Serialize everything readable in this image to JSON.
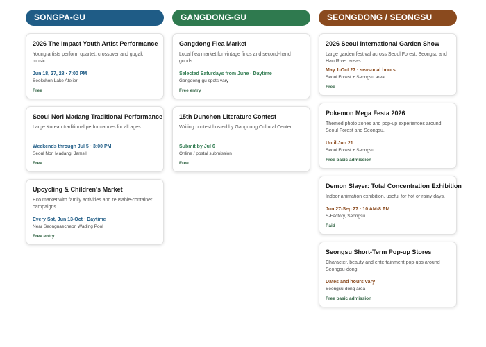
{
  "colors": {
    "songpa": "#1f5c86",
    "gangdong": "#2f7a4f",
    "seongdong": "#8a4a1e"
  },
  "columns": [
    {
      "header": "SONGPA-GU",
      "cards": [
        {
          "title": "2026 The Impact Youth Artist Performance",
          "desc": "Young artists perform quartet, crossover and gugak music.",
          "date": "Jun 18, 27, 28 · 7:00 PM",
          "location": "Seokchon Lake Atelier",
          "price": "Free"
        },
        {
          "title": "Seoul Nori Madang Traditional Performance",
          "desc": "Large Korean traditional performances for all ages.",
          "date": "Weekends through Jul 5 · 3:00 PM",
          "location": "Seoul Nori Madang, Jamsil",
          "price": "Free"
        },
        {
          "title": "Upcycling & Children's Market",
          "desc": "Eco market with family activities and reusable-container campaigns.",
          "date": "Every Sat, Jun 13-Oct · Daytime",
          "location": "Near Seongnaecheon Wading Pool",
          "price": "Free entry"
        }
      ]
    },
    {
      "header": "GANGDONG-GU",
      "cards": [
        {
          "title": "Gangdong Flea Market",
          "desc": "Local flea market for vintage finds and second-hand goods.",
          "date": "Selected Saturdays from June · Daytime",
          "location": "Gangdong-gu spots vary",
          "price": "Free entry"
        },
        {
          "title": "15th Dunchon Literature Contest",
          "desc": "Writing contest hosted by Gangdong Cultural Center.",
          "date": "Submit by Jul 6",
          "location": "Online / postal submission",
          "price": "Free"
        }
      ]
    },
    {
      "header": "SEONGDONG / SEONGSU",
      "cards": [
        {
          "title": "2026 Seoul International Garden Show",
          "desc": "Large garden festival across Seoul Forest, Seongsu and Han River areas.",
          "date": "May 1-Oct 27 · seasonal hours",
          "location": "Seoul Forest + Seongsu area",
          "price": "Free"
        },
        {
          "title": "Pokemon Mega Festa 2026",
          "desc": "Themed photo zones and pop-up experiences around Seoul Forest and Seongsu.",
          "date": "Until Jun 21",
          "location": "Seoul Forest + Seongsu",
          "price": "Free basic admission"
        },
        {
          "title": "Demon Slayer: Total Concentration Exhibition",
          "desc": "Indoor animation exhibition, useful for hot or rainy days.",
          "date": "Jun 27-Sep 27 · 10 AM-8 PM",
          "location": "S-Factory, Seongsu",
          "price": "Paid"
        },
        {
          "title": "Seongsu Short-Term Pop-up Stores",
          "desc": "Character, beauty and entertainment pop-ups around Seongsu-dong.",
          "date": "Dates and hours vary",
          "location": "Seongsu-dong area",
          "price": "Free basic admission"
        }
      ]
    }
  ]
}
